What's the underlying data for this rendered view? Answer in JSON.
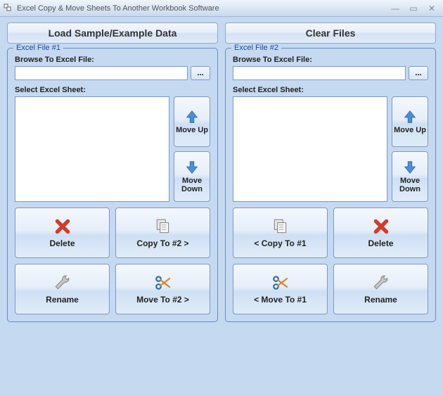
{
  "window": {
    "title": "Excel Copy & Move Sheets To Another Workbook Software"
  },
  "topButtons": {
    "loadSample": "Load Sample/Example Data",
    "clearFiles": "Clear Files"
  },
  "panel1": {
    "legend": "Excel File #1",
    "browseLabel": "Browse To Excel File:",
    "browseValue": "",
    "browseBtn": "...",
    "sheetLabel": "Select Excel Sheet:",
    "moveUp": "Move Up",
    "moveDown": "Move Down",
    "delete": "Delete",
    "copyTo": "Copy To #2 >",
    "rename": "Rename",
    "moveTo": "Move To #2 >"
  },
  "panel2": {
    "legend": "Excel File #2",
    "browseLabel": "Browse To Excel File:",
    "browseValue": "",
    "browseBtn": "...",
    "sheetLabel": "Select Excel Sheet:",
    "moveUp": "Move Up",
    "moveDown": "Move Down",
    "copyTo": "< Copy To #1",
    "delete": "Delete",
    "moveTo": "< Move To #1",
    "rename": "Rename"
  }
}
